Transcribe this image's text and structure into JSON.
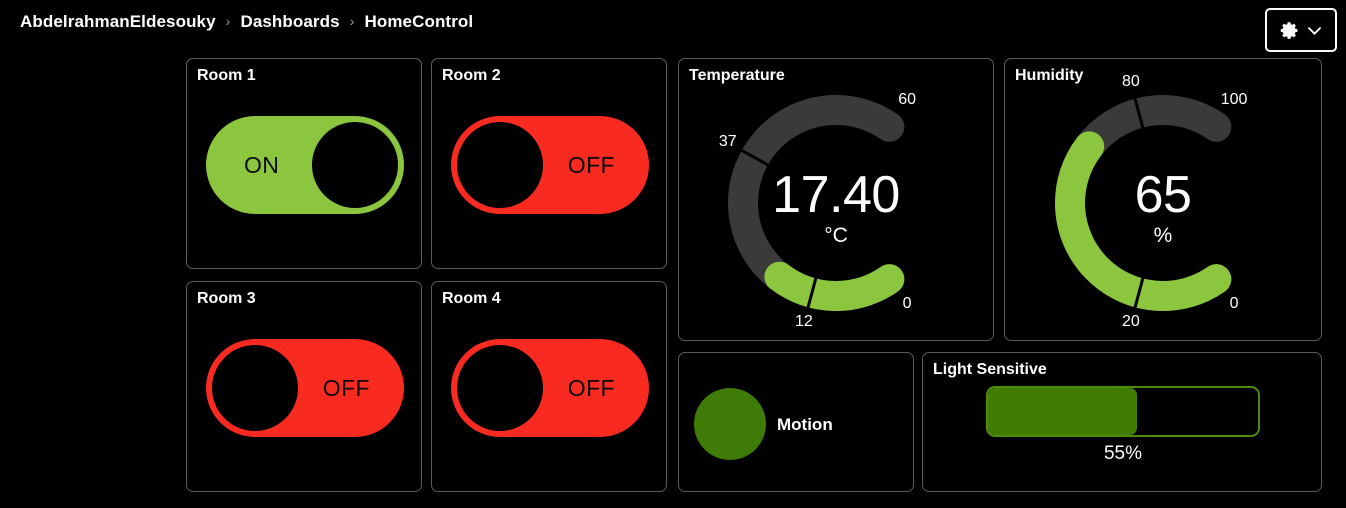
{
  "header": {
    "breadcrumb": [
      "AbdelrahmanEldesouky",
      "Dashboards",
      "HomeControl"
    ],
    "separator": "›",
    "settings_icon": "gear-icon",
    "settings_chevron": "chevron-down-icon"
  },
  "rooms": [
    {
      "title": "Room 1",
      "state": "ON",
      "state_label": "ON",
      "color": "#8CC63F"
    },
    {
      "title": "Room 2",
      "state": "OFF",
      "state_label": "OFF",
      "color": "#F92B20"
    },
    {
      "title": "Room 3",
      "state": "OFF",
      "state_label": "OFF",
      "color": "#F92B20"
    },
    {
      "title": "Room 4",
      "state": "OFF",
      "state_label": "OFF",
      "color": "#F92B20"
    }
  ],
  "gauges": [
    {
      "title": "Temperature",
      "value": "17.40",
      "unit": "°C",
      "min_label": "0",
      "max_label": "60",
      "marker_low": "12",
      "marker_high": "37",
      "arc_color": "#8CC63F",
      "track_color": "#3A3A3A"
    },
    {
      "title": "Humidity",
      "value": "65",
      "unit": "%",
      "min_label": "0",
      "max_label": "100",
      "marker_low": "20",
      "marker_high": "80",
      "arc_color": "#8CC63F",
      "track_color": "#3A3A3A"
    }
  ],
  "motion": {
    "label": "Motion",
    "led_color": "#3F7B07"
  },
  "light": {
    "title": "Light Sensitive",
    "percent_label": "55%",
    "fill_color": "#427D03",
    "border_color": "#4E8C0C"
  },
  "chart_data": [
    {
      "type": "gauge",
      "title": "Temperature",
      "value": 17.4,
      "unit": "°C",
      "min": 0,
      "max": 60,
      "thresholds": [
        12,
        37
      ],
      "tick_labels": [
        "0",
        "12",
        "37",
        "60"
      ],
      "value_color": "#8CC63F",
      "track_color": "#3A3A3A"
    },
    {
      "type": "gauge",
      "title": "Humidity",
      "value": 65,
      "unit": "%",
      "min": 0,
      "max": 100,
      "thresholds": [
        20,
        80
      ],
      "tick_labels": [
        "0",
        "20",
        "80",
        "100"
      ],
      "value_color": "#8CC63F",
      "track_color": "#3A3A3A"
    },
    {
      "type": "bar",
      "title": "Light Sensitive",
      "categories": [
        "Light Sensitive"
      ],
      "values": [
        55
      ],
      "ylim": [
        0,
        100
      ],
      "unit": "%",
      "orientation": "horizontal"
    }
  ]
}
